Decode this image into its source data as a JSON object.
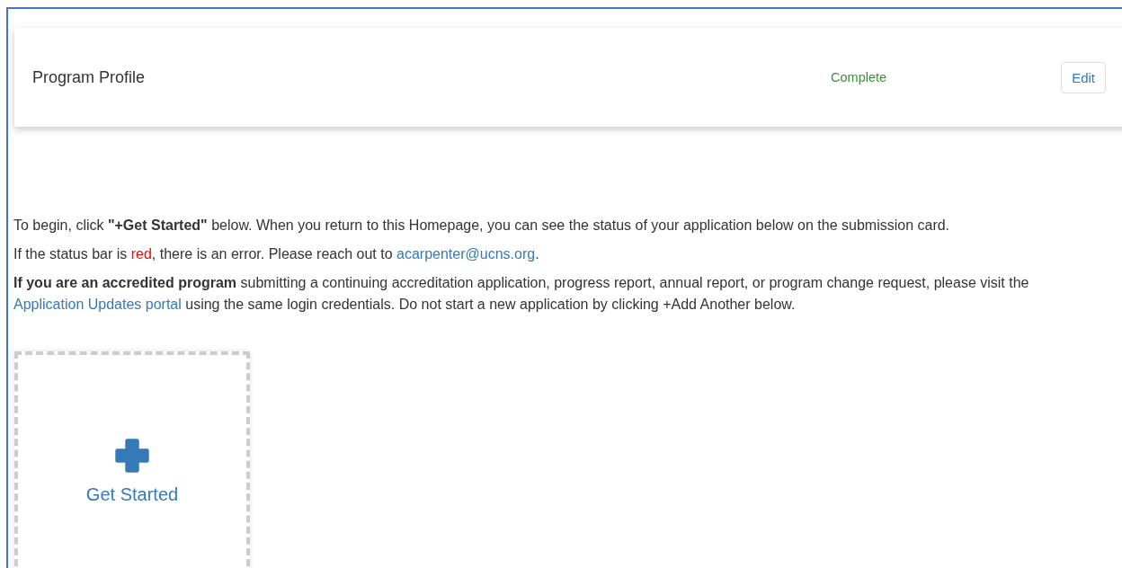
{
  "profile_card": {
    "title": "Program Profile",
    "status": "Complete",
    "button": "Edit"
  },
  "paragraphs": [
    {
      "parts": [
        {
          "kind": "text",
          "text": "To begin, click **\"+Get Started\"** below. When you return to this Homepage, you can see the status of your application below on the submission card."
        }
      ]
    },
    {
      "parts": [
        {
          "kind": "text",
          "text": "If the status bar is "
        },
        {
          "kind": "alert",
          "text": "red"
        },
        {
          "kind": "text",
          "text": ", there is an error. Please reach out to "
        },
        {
          "kind": "link",
          "text": "acarpenter@ucns.org"
        },
        {
          "kind": "text",
          "text": "."
        }
      ]
    },
    {
      "parts": [
        {
          "kind": "text",
          "text": "**If you are an accredited program** submitting a continuing accreditation application, progress report, annual report, or program change request, please visit the "
        },
        {
          "kind": "link",
          "text": "Application Updates portal"
        },
        {
          "kind": "text",
          "text": " using the same login credentials. Do not start a new application by clicking +Add Another below."
        }
      ]
    }
  ],
  "add_card": {
    "label": "Get Started"
  }
}
